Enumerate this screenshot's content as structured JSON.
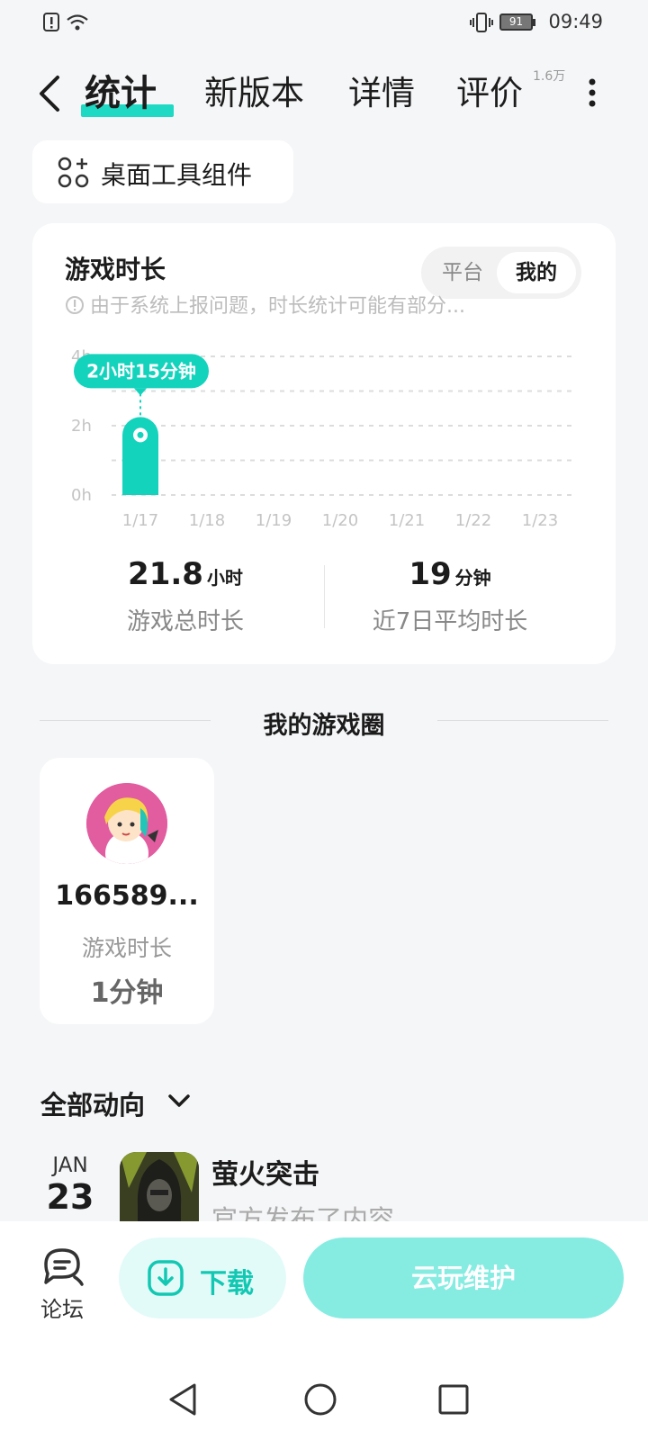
{
  "status_bar": {
    "time": "09:49",
    "battery": "91"
  },
  "nav": {
    "tabs": [
      {
        "label": "统计",
        "active": true
      },
      {
        "label": "新版本",
        "active": false
      },
      {
        "label": "详情",
        "active": false
      },
      {
        "label": "评价",
        "active": false
      }
    ],
    "rating_count": "1.6万",
    "accent": "#1ed9c3"
  },
  "widget_button": {
    "label": "桌面工具组件"
  },
  "stats": {
    "title": "游戏时长",
    "toggle": {
      "platform": "平台",
      "mine": "我的",
      "selected": "我的"
    },
    "notice": "由于系统上报问题，时长统计可能有部分...",
    "total": {
      "value": "21.8",
      "unit": "小时",
      "caption": "游戏总时长"
    },
    "average": {
      "value": "19",
      "unit": "分钟",
      "caption": "近7日平均时长"
    }
  },
  "chart_data": {
    "type": "bar",
    "categories": [
      "1/17",
      "1/18",
      "1/19",
      "1/20",
      "1/21",
      "1/22",
      "1/23"
    ],
    "values": [
      2.25,
      0,
      0,
      0,
      0,
      0,
      0
    ],
    "unit": "h",
    "y_ticks": [
      "0h",
      "2h",
      "4h"
    ],
    "ylim": [
      0,
      4
    ],
    "tooltip": {
      "category": "1/17",
      "text": "2小时15分钟"
    },
    "grid": true,
    "color": "#14d3bd"
  },
  "circle": {
    "section_title": "我的游戏圈",
    "card": {
      "user_id": "166589...",
      "caption": "游戏时长",
      "value": "1分钟"
    }
  },
  "feed": {
    "filter_label": "全部动向",
    "items": [
      {
        "month": "JAN",
        "day": "23",
        "title": "萤火突击",
        "subtitle": "官方发布了内容"
      }
    ]
  },
  "bottom_bar": {
    "forum_label": "论坛",
    "download_label": "下载",
    "cloud_label": "云玩维护"
  }
}
